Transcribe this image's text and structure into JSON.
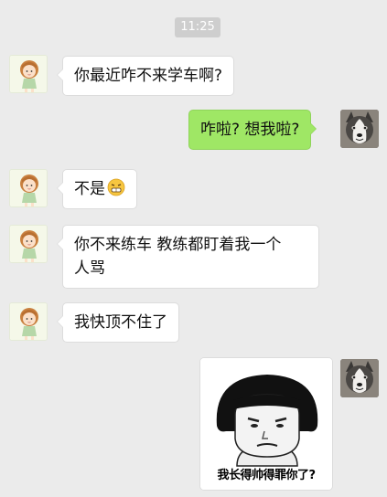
{
  "chat": {
    "timestamp": "11:25",
    "messages": [
      {
        "side": "in",
        "text": "你最近咋不来学车啊?"
      },
      {
        "side": "out",
        "text": "咋啦? 想我啦?"
      },
      {
        "side": "in",
        "text": "不是",
        "emoji": "grimace-emoji"
      },
      {
        "side": "in",
        "line1": "你不来练车 教练都盯着我一个",
        "line2": "人骂"
      },
      {
        "side": "in",
        "text": "我快顶不住了"
      },
      {
        "side": "out",
        "sticker_caption": "我长得帅得罪你了?"
      }
    ]
  },
  "icons": {
    "girl_avatar": "girl-avatar-icon",
    "dog_avatar": "husky-avatar-icon",
    "sticker": "mushroom-head-meme-sticker"
  },
  "colors": {
    "background": "#ebebeb",
    "outgoing_bubble": "#9fe765",
    "incoming_bubble": "#ffffff",
    "timestamp_badge": "#cecece"
  }
}
